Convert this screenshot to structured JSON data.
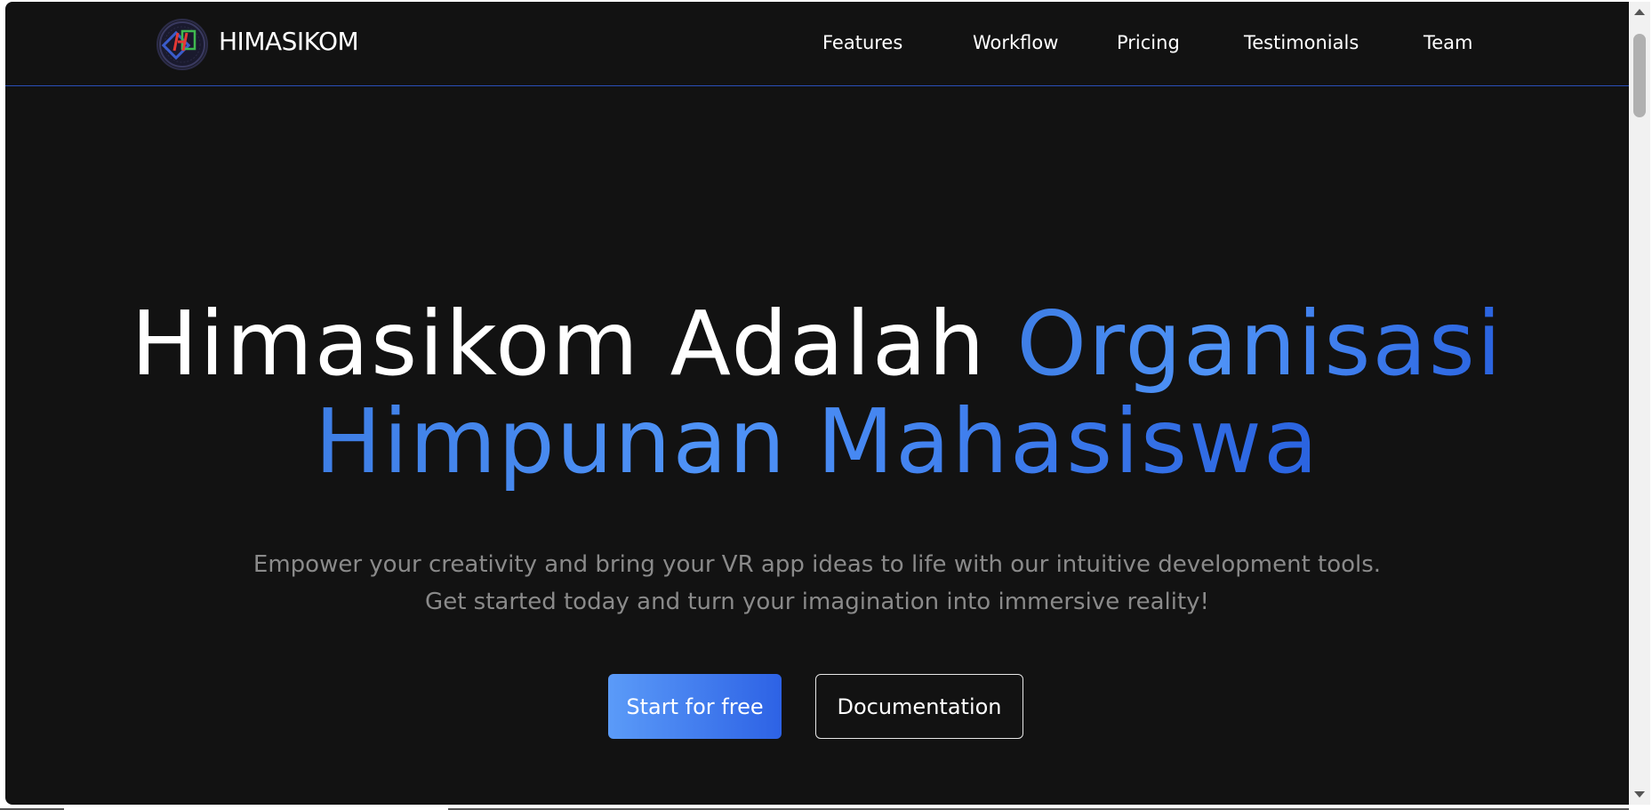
{
  "brand": {
    "name": "HIMASIKOM",
    "logo_icon": "himasikom-logo-icon"
  },
  "nav": {
    "items": [
      {
        "label": "Features"
      },
      {
        "label": "Workflow"
      },
      {
        "label": "Pricing"
      },
      {
        "label": "Testimonials"
      },
      {
        "label": "Team"
      }
    ]
  },
  "hero": {
    "title_white": "Himasikom Adalah ",
    "title_accent_1": "Organisasi",
    "title_accent_2": "Himpunan Mahasiswa",
    "subtitle_line1": "Empower your creativity and bring your VR app ideas to life with our intuitive development tools.",
    "subtitle_line2": "Get started today and turn your imagination into immersive reality!",
    "primary_button": "Start for free",
    "secondary_button": "Documentation"
  },
  "colors": {
    "background": "#121212",
    "accent": "#3b82f6",
    "divider": "#2a4fb8",
    "muted_text": "#8a8a8a"
  }
}
